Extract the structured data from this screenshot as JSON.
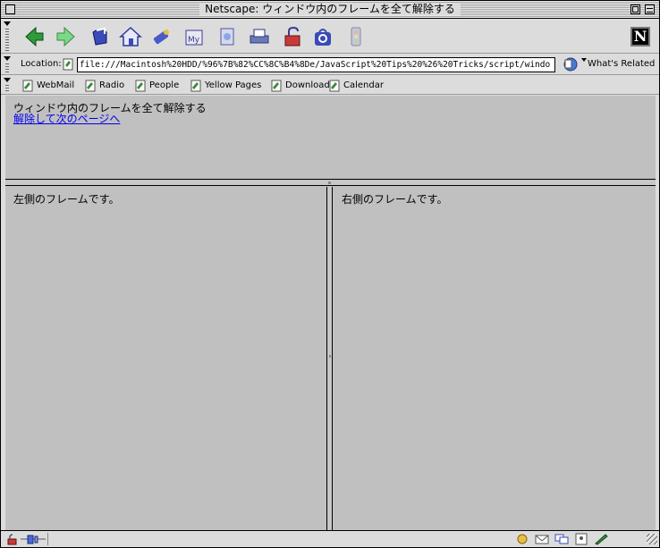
{
  "window": {
    "title": "Netscape: ウィンドウ内のフレームを全て解除する"
  },
  "nav_toolbar": {
    "buttons": [
      {
        "name": "back-icon",
        "color": "#2e9a3a"
      },
      {
        "name": "forward-icon",
        "color": "#5ec86a"
      },
      {
        "name": "reload-icon",
        "color": "#2a3aa8"
      },
      {
        "name": "home-icon",
        "color": "#3a4ab8"
      },
      {
        "name": "search-icon",
        "color": "#c8a020"
      },
      {
        "name": "my-netscape-icon",
        "color": "#6a3aa8"
      },
      {
        "name": "images-icon",
        "color": "#3a8ac8"
      },
      {
        "name": "print-icon",
        "color": "#4a5ab0"
      },
      {
        "name": "security-icon",
        "color": "#c83a3a"
      },
      {
        "name": "shop-icon",
        "color": "#3a4ab8"
      },
      {
        "name": "stop-icon",
        "color": "#b8b8c8"
      }
    ],
    "logo": "N"
  },
  "location_bar": {
    "label": "Location:",
    "url": "file:///Macintosh%20HDD/%96%7B%82%CC%8C%B4%8De/JavaScript%20Tips%20%26%20Tricks/script/windo",
    "related_label": "What's Related"
  },
  "personal_toolbar": {
    "items": [
      {
        "label": "WebMail"
      },
      {
        "label": "Radio"
      },
      {
        "label": "People"
      },
      {
        "label": "Yellow Pages"
      },
      {
        "label": "Download"
      },
      {
        "label": "Calendar"
      }
    ]
  },
  "frames": {
    "top": {
      "text": "ウィンドウ内のフレームを全て解除する",
      "link": "解除して次のページへ"
    },
    "left": {
      "text": "左側のフレームです。"
    },
    "right": {
      "text": "右側のフレームです。"
    }
  }
}
